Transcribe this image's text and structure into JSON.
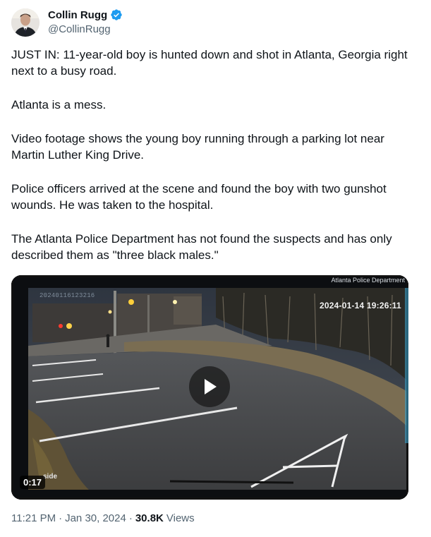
{
  "author": {
    "display_name": "Collin Rugg",
    "handle": "@CollinRugg",
    "verified": true,
    "verified_color": "#1d9bf0",
    "avatar_icon": "profile-photo"
  },
  "tweet": {
    "paragraphs": [
      "JUST IN: 11-year-old boy is hunted down and shot in Atlanta, Georgia right next to a busy road.",
      "Atlanta is a mess.",
      "Video footage shows the young boy running through a parking lot near Martin Luther King Drive.",
      "Police officers arrived at the scene and found the boy with two gunshot wounds. He was taken to the hospital.",
      "The Atlanta Police Department has not found the suspects and has only described them as \"three black males.\""
    ]
  },
  "media": {
    "type": "video",
    "corner_label": "Atlanta Police Department",
    "camera_id": "20240116123216",
    "camera_timestamp": "2024-01-14 19:26:11",
    "overlay_text": "side",
    "duration": "0:17",
    "play_icon": "play-icon"
  },
  "meta": {
    "time": "11:21 PM",
    "separator": "·",
    "date": "Jan 30, 2024",
    "views_count": "30.8K",
    "views_label": "Views"
  }
}
